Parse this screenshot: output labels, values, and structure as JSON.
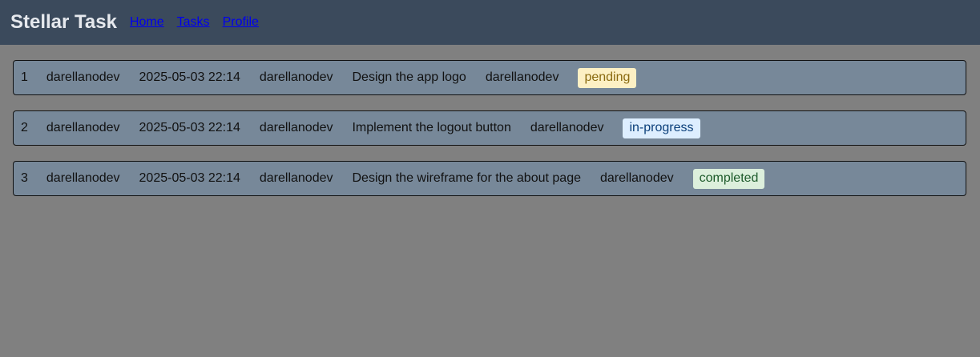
{
  "app": {
    "title": "Stellar Task"
  },
  "nav": {
    "home": "Home",
    "tasks": "Tasks",
    "profile": "Profile"
  },
  "tasks": [
    {
      "id": "1",
      "user": "darellanodev",
      "date": "2025-05-03 22:14",
      "owner": "darellanodev",
      "title": "Design the app logo",
      "assignee": "darellanodev",
      "status": "pending"
    },
    {
      "id": "2",
      "user": "darellanodev",
      "date": "2025-05-03 22:14",
      "owner": "darellanodev",
      "title": "Implement the logout button",
      "assignee": "darellanodev",
      "status": "in-progress"
    },
    {
      "id": "3",
      "user": "darellanodev",
      "date": "2025-05-03 22:14",
      "owner": "darellanodev",
      "title": "Design the wireframe for the about page",
      "assignee": "darellanodev",
      "status": "completed"
    }
  ],
  "colors": {
    "navbar": "#3b4a5c",
    "background": "#808080",
    "row": "#778899",
    "pending_bg": "#fdf0c4",
    "in_progress_bg": "#ddeeff",
    "completed_bg": "#dcefdc"
  }
}
